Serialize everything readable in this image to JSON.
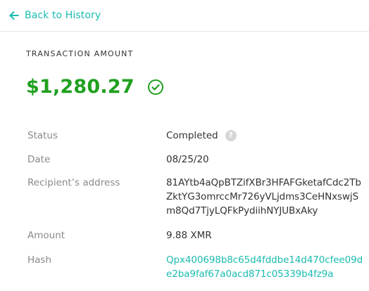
{
  "nav": {
    "back_label": "Back to History"
  },
  "transaction": {
    "section_title": "TRANSACTION AMOUNT",
    "amount": "$1,280.27"
  },
  "details": {
    "status_label": "Status",
    "status_value": "Completed",
    "date_label": "Date",
    "date_value": "08/25/20",
    "recipient_label": "Recipient’s address",
    "recipient_value": "81AYtb4aQpBTZifXBr3HFAFGketafCdc2TbZktYG3omrccMr726yVLjdms3CeHNxswjSm8Qd7TjyLQFkPydiihNYJUBxAky",
    "amount_label": "Amount",
    "amount_value": "9.88 XMR",
    "hash_label": "Hash",
    "hash_value": "Qpx400698b8c65d4fddbe14d470cfee09de2ba9faf67a0acd871c05339b4fz9a"
  },
  "icons": {
    "back": "arrow-left-icon",
    "success": "check-circle-icon",
    "help": "question-circle-icon"
  },
  "colors": {
    "accent": "#1bbcb0",
    "success": "#20a020",
    "muted": "#8a8a8a",
    "help_bg": "#d6d6d6"
  }
}
